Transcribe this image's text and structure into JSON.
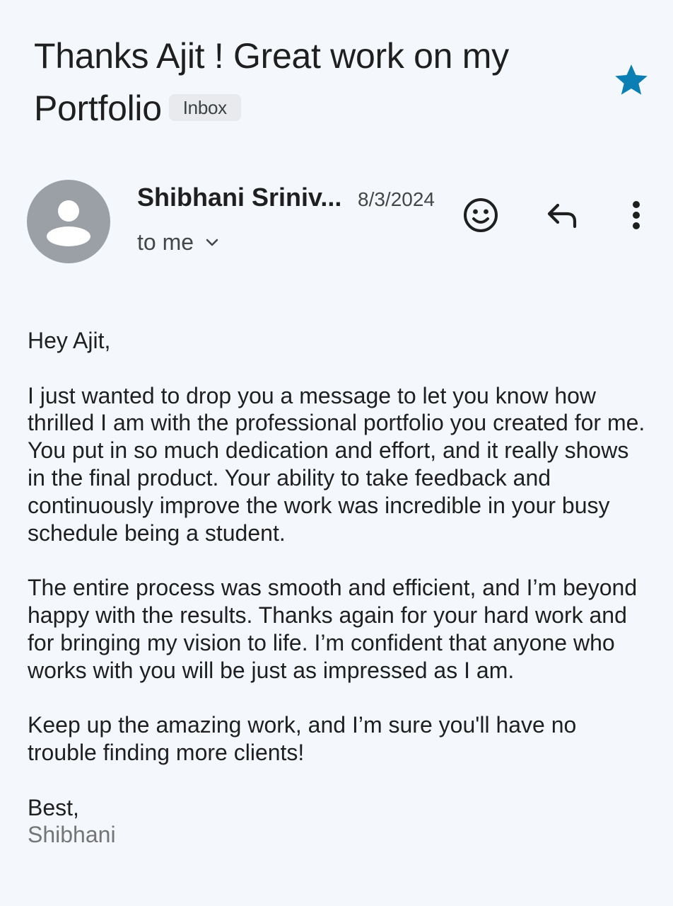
{
  "email": {
    "subject": "Thanks Ajit ! Great work on my Portfolio",
    "label_chip": "Inbox",
    "starred": true,
    "sender_name": "Shibhani Sriniv...",
    "date": "8/3/2024",
    "recipient": "to me",
    "body": {
      "greeting": "Hey Ajit,",
      "paragraph1": "I just wanted to drop you a message to let you know how thrilled I am with the professional portfolio you created for me. You put in so much dedication and effort, and it really shows in the final product. Your ability to take feedback and continuously improve the work was incredible in your busy schedule being a student.",
      "paragraph2": "The entire process was smooth and efficient, and I’m beyond happy with the results. Thanks again for your hard work and for bringing my vision to life. I’m confident that anyone who works with you will be just as impressed as I am.",
      "paragraph3": "Keep up the amazing work, and I’m sure you'll have no trouble finding more clients!",
      "closing": "Best,",
      "signature": "Shibhani"
    }
  },
  "icons": {
    "star": "star-filled-icon",
    "avatar": "person-avatar-icon",
    "recipient_expand": "chevron-down-icon",
    "emoji": "smiley-face-icon",
    "reply": "reply-arrow-icon",
    "more": "more-vertical-icon"
  },
  "colors": {
    "background": "#f4f8fd",
    "star": "#0b7fb3",
    "avatar": "#9aa0a6",
    "chip_bg": "#e8eaed",
    "signature": "#757575"
  }
}
